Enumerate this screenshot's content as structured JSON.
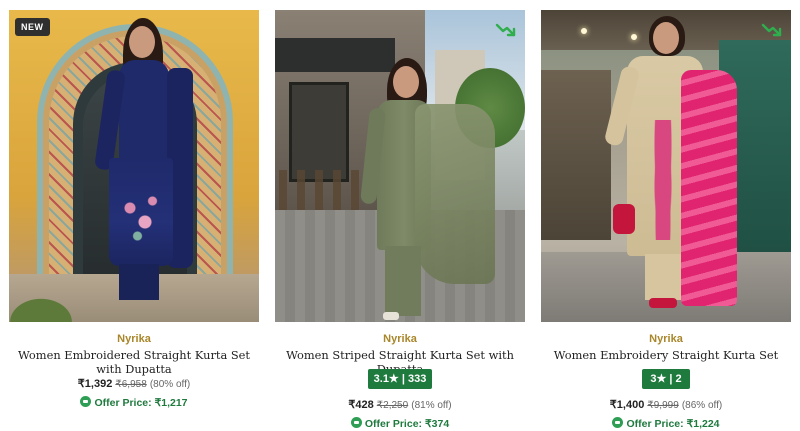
{
  "products": [
    {
      "badge": "NEW",
      "brand": "Nyrika",
      "title": "Women Embroidered Straight Kurta Set with Dupatta",
      "price": "₹1,392",
      "mrp": "₹6,958",
      "discount": "(80% off)",
      "offer_label": "Offer Price:",
      "offer_price": "₹1,217"
    },
    {
      "brand": "Nyrika",
      "title": "Women Striped Straight Kurta Set with Dupatta",
      "rating": "3.1★ | 333",
      "price": "₹428",
      "mrp": "₹2,250",
      "discount": "(81% off)",
      "offer_label": "Offer Price:",
      "offer_price": "₹374",
      "icon": "trending-icon"
    },
    {
      "brand": "Nyrika",
      "title": "Women Embroidery Straight Kurta Set",
      "rating": "3★ | 2",
      "price": "₹1,400",
      "mrp": "₹9,999",
      "discount": "(86% off)",
      "offer_label": "Offer Price:",
      "offer_price": "₹1,224",
      "icon": "trending-icon"
    }
  ],
  "colors": {
    "brand": "#a98629",
    "rating_bg": "#1f7a3e",
    "offer": "#1f7a3e",
    "badge_bg": "#2f2f2f"
  }
}
